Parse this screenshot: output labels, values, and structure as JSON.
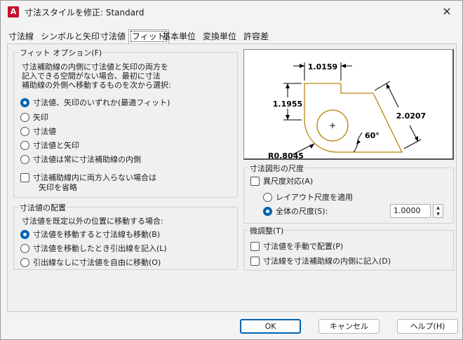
{
  "window": {
    "title": "寸法スタイルを修正: Standard",
    "app_icon_letter": "A",
    "close_glyph": "✕"
  },
  "tabs": [
    {
      "label": "寸法線"
    },
    {
      "label": "シンボルと矢印"
    },
    {
      "label": "寸法値"
    },
    {
      "label": "フィット"
    },
    {
      "label": "基本単位"
    },
    {
      "label": "変換単位"
    },
    {
      "label": "許容差"
    }
  ],
  "active_tab": "フィット",
  "fit_options": {
    "legend": "フィット オプション(F)",
    "description": [
      "寸法補助線の内側に寸法値と矢印の両方を",
      "記入できる空間がない場合、最初に寸法",
      "補助線の外側へ移動するものを次から選択:"
    ],
    "radios": [
      {
        "label": "寸法値、矢印のいずれか(最適フィット)",
        "selected": true
      },
      {
        "label": "矢印",
        "selected": false
      },
      {
        "label": "寸法値",
        "selected": false
      },
      {
        "label": "寸法値と矢印",
        "selected": false
      },
      {
        "label": "寸法値は常に寸法補助線の内側",
        "selected": false
      }
    ],
    "suppress_checkbox": {
      "line1": "寸法補助線内に両方入らない場合は",
      "line2": "矢印を省略",
      "checked": false
    }
  },
  "text_placement": {
    "legend": "寸法値の配置",
    "description": "寸法値を既定以外の位置に移動する場合:",
    "radios": [
      {
        "label": "寸法値を移動すると寸法線も移動(B)",
        "selected": true
      },
      {
        "label": "寸法値を移動したとき引出線を記入(L)",
        "selected": false
      },
      {
        "label": "引出線なしに寸法値を自由に移動(O)",
        "selected": false
      }
    ]
  },
  "preview": {
    "dims": {
      "top": "1.0159",
      "left": "1.1955",
      "right": "2.0207",
      "angle": "60°",
      "radius": "R0.8045"
    },
    "center_mark": "+"
  },
  "scale": {
    "legend": "寸法図形の尺度",
    "annotative_label": "異尺度対応(A)",
    "annotative_checked": false,
    "radios": [
      {
        "label": "レイアウト尺度を適用",
        "selected": false
      },
      {
        "label": "全体の尺度(S):",
        "selected": true
      }
    ],
    "overall_scale_value": "1.0000",
    "spin_up": "▲",
    "spin_down": "▼"
  },
  "fine_tuning": {
    "legend": "微調整(T)",
    "checkboxes": [
      {
        "label": "寸法値を手動で配置(P)",
        "checked": false
      },
      {
        "label": "寸法線を寸法補助線の内側に記入(D)",
        "checked": false
      }
    ]
  },
  "buttons": {
    "ok": "OK",
    "cancel": "キャンセル",
    "help": "ヘルプ(H)"
  },
  "colors": {
    "accent": "#0063b1",
    "preview_outline": "#b8860b",
    "app_icon": "#c8102e"
  }
}
